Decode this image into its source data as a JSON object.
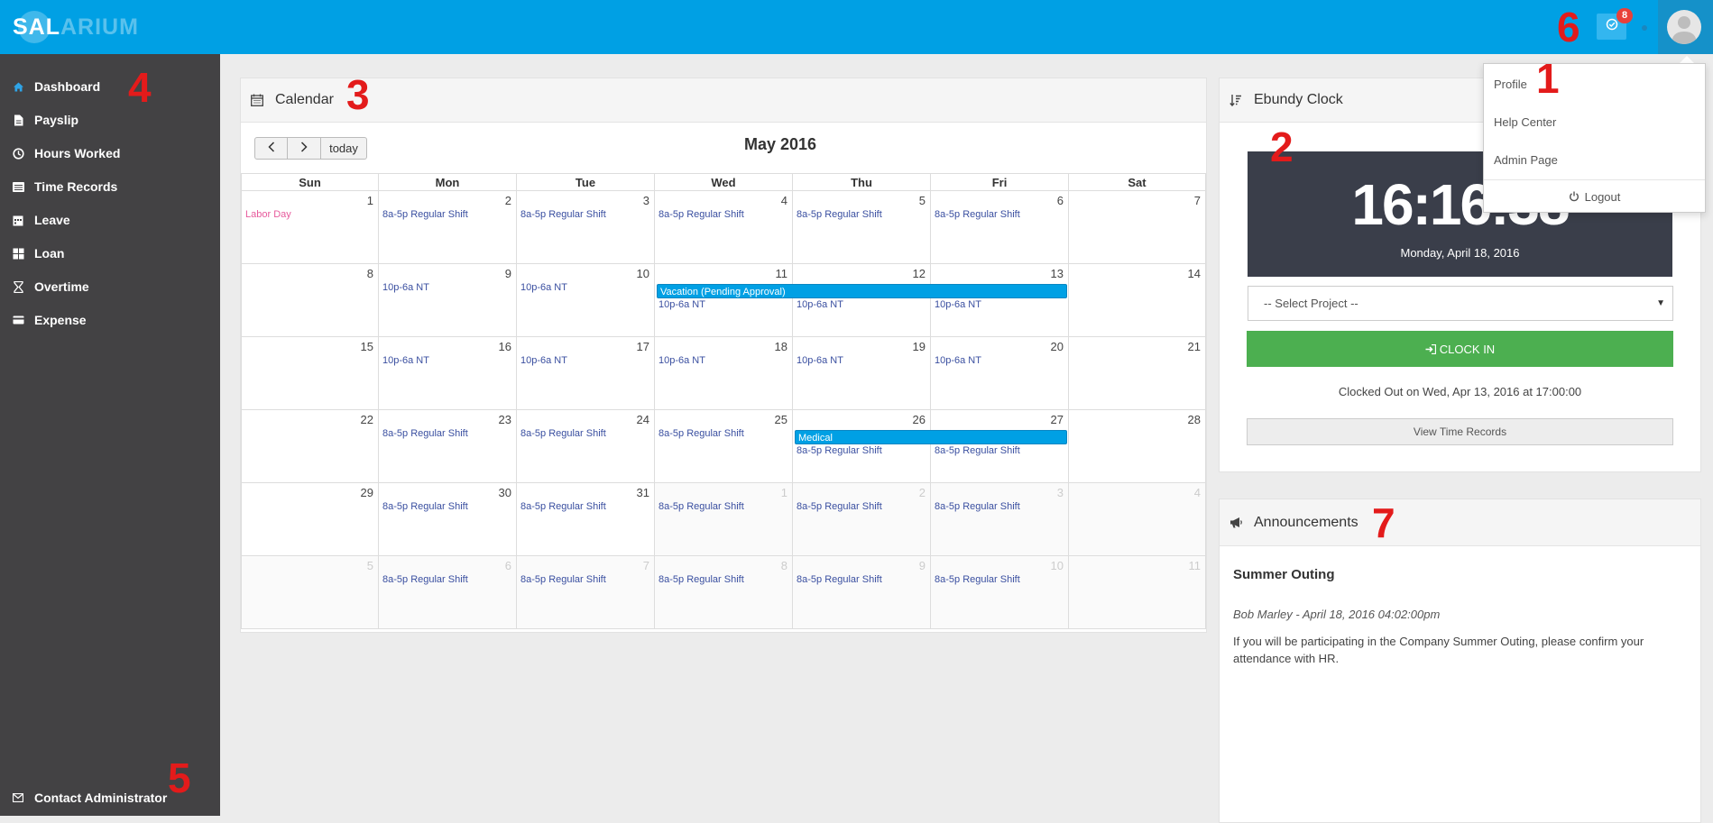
{
  "app": {
    "logo_part1": "SAL",
    "logo_part2": "ARIUM"
  },
  "topbar": {
    "notification_count": "8"
  },
  "user_menu": {
    "items": [
      "Profile",
      "Help Center",
      "Admin Page"
    ],
    "logout": "Logout"
  },
  "sidebar": {
    "items": [
      {
        "label": "Dashboard",
        "icon": "home-icon"
      },
      {
        "label": "Payslip",
        "icon": "file-icon"
      },
      {
        "label": "Hours Worked",
        "icon": "clock-icon"
      },
      {
        "label": "Time Records",
        "icon": "list-icon"
      },
      {
        "label": "Leave",
        "icon": "calendar-icon"
      },
      {
        "label": "Loan",
        "icon": "grid-icon"
      },
      {
        "label": "Overtime",
        "icon": "hourglass-icon"
      },
      {
        "label": "Expense",
        "icon": "credit-card-icon"
      }
    ],
    "contact": "Contact Administrator"
  },
  "calendar": {
    "title": "Calendar",
    "month_title": "May 2016",
    "today_label": "today",
    "days": [
      "Sun",
      "Mon",
      "Tue",
      "Wed",
      "Thu",
      "Fri",
      "Sat"
    ],
    "weeks": [
      [
        {
          "d": "1",
          "ev": [
            "Labor Day"
          ],
          "holiday": true
        },
        {
          "d": "2",
          "ev": [
            "8a-5p Regular Shift"
          ]
        },
        {
          "d": "3",
          "ev": [
            "8a-5p Regular Shift"
          ]
        },
        {
          "d": "4",
          "ev": [
            "8a-5p Regular Shift"
          ]
        },
        {
          "d": "5",
          "ev": [
            "8a-5p Regular Shift"
          ]
        },
        {
          "d": "6",
          "ev": [
            "8a-5p Regular Shift"
          ]
        },
        {
          "d": "7",
          "ev": []
        }
      ],
      [
        {
          "d": "8",
          "ev": []
        },
        {
          "d": "9",
          "ev": [
            "10p-6a NT"
          ]
        },
        {
          "d": "10",
          "ev": [
            "10p-6a NT"
          ]
        },
        {
          "d": "11",
          "ev": [
            "10p-6a NT"
          ],
          "bar": true
        },
        {
          "d": "12",
          "ev": [
            "10p-6a NT"
          ],
          "bar": true
        },
        {
          "d": "13",
          "ev": [
            "10p-6a NT"
          ],
          "bar": true
        },
        {
          "d": "14",
          "ev": []
        }
      ],
      [
        {
          "d": "15",
          "ev": []
        },
        {
          "d": "16",
          "ev": [
            "10p-6a NT"
          ]
        },
        {
          "d": "17",
          "ev": [
            "10p-6a NT"
          ]
        },
        {
          "d": "18",
          "ev": [
            "10p-6a NT"
          ]
        },
        {
          "d": "19",
          "ev": [
            "10p-6a NT"
          ]
        },
        {
          "d": "20",
          "ev": [
            "10p-6a NT"
          ]
        },
        {
          "d": "21",
          "ev": []
        }
      ],
      [
        {
          "d": "22",
          "ev": []
        },
        {
          "d": "23",
          "ev": [
            "8a-5p Regular Shift"
          ]
        },
        {
          "d": "24",
          "ev": [
            "8a-5p Regular Shift"
          ]
        },
        {
          "d": "25",
          "ev": [
            "8a-5p Regular Shift"
          ]
        },
        {
          "d": "26",
          "ev": [
            "8a-5p Regular Shift"
          ],
          "bar": true
        },
        {
          "d": "27",
          "ev": [
            "8a-5p Regular Shift"
          ],
          "bar": true
        },
        {
          "d": "28",
          "ev": []
        }
      ],
      [
        {
          "d": "29",
          "ev": []
        },
        {
          "d": "30",
          "ev": [
            "8a-5p Regular Shift"
          ]
        },
        {
          "d": "31",
          "ev": [
            "8a-5p Regular Shift"
          ]
        },
        {
          "d": "1",
          "ev": [
            "8a-5p Regular Shift"
          ],
          "other": true
        },
        {
          "d": "2",
          "ev": [
            "8a-5p Regular Shift"
          ],
          "other": true
        },
        {
          "d": "3",
          "ev": [
            "8a-5p Regular Shift"
          ],
          "other": true
        },
        {
          "d": "4",
          "ev": [],
          "other": true
        }
      ],
      [
        {
          "d": "5",
          "ev": [],
          "other": true
        },
        {
          "d": "6",
          "ev": [
            "8a-5p Regular Shift"
          ],
          "other": true
        },
        {
          "d": "7",
          "ev": [
            "8a-5p Regular Shift"
          ],
          "other": true
        },
        {
          "d": "8",
          "ev": [
            "8a-5p Regular Shift"
          ],
          "other": true
        },
        {
          "d": "9",
          "ev": [
            "8a-5p Regular Shift"
          ],
          "other": true
        },
        {
          "d": "10",
          "ev": [
            "8a-5p Regular Shift"
          ],
          "other": true
        },
        {
          "d": "11",
          "ev": [],
          "other": true
        }
      ]
    ],
    "vacation_event": "Vacation (Pending Approval)",
    "medical_event": "Medical"
  },
  "clock": {
    "title": "Ebundy Clock",
    "time": "16:16:38",
    "date": "Monday, April 18, 2016",
    "select_placeholder": "-- Select Project --",
    "clock_in": "CLOCK IN",
    "status": "Clocked Out on Wed, Apr 13, 2016 at 17:00:00",
    "view_records": "View Time Records"
  },
  "announcements": {
    "title": "Announcements",
    "item_title": "Summer Outing",
    "meta": "Bob Marley - April 18, 2016 04:02:00pm",
    "body": "If you will be participating in the Company Summer Outing, please confirm your attendance with HR."
  },
  "annotations": [
    "1",
    "2",
    "3",
    "4",
    "5",
    "6",
    "7"
  ]
}
